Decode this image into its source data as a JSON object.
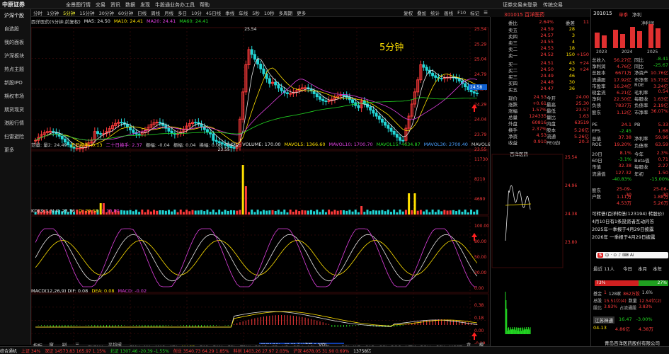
{
  "app": {
    "logo": "中原证券",
    "menu": [
      "全景图",
      "行情",
      "交易",
      "资讯",
      "数据",
      "发现",
      "牛股通",
      "业务办理",
      "工具",
      "帮助"
    ],
    "login": "证券交易未登录",
    "right_links": [
      "传统交易",
      "全"
    ]
  },
  "left_nav": [
    "沪深个股",
    "自选股",
    "我的面板",
    "沪深板块",
    "热点主题",
    "新股IPO",
    "期权市场",
    "期货现货",
    "港股行情",
    "扫雷避险",
    "更多"
  ],
  "chart_toolbar": {
    "items": [
      "分时",
      "1分钟",
      "5分钟",
      "15分钟",
      "30分钟",
      "60分钟",
      "日线",
      "周线",
      "月线",
      "多日",
      "10分",
      "45日线",
      "季线",
      "年线",
      "5秒",
      "10秒",
      "多周期",
      "更多"
    ],
    "active": "5分钟",
    "right_items": [
      "复权",
      "叠加",
      "统计",
      "画线",
      "F10",
      "标记",
      "☰"
    ]
  },
  "main_chart": {
    "title": "西洋医药(5分钟,前复权)",
    "ma_labels": [
      {
        "t": "MA5: 24.50",
        "c": "#e6e6e6"
      },
      {
        "t": "MA10: 24.41",
        "c": "#ffe000"
      },
      {
        "t": "MA20: 24.41",
        "c": "#e040e0"
      },
      {
        "t": "MA60: 24.41",
        "c": "#22d622"
      }
    ],
    "period_label": "5分钟",
    "high_label": "25.54",
    "low_label": "23.55",
    "price_axis": [
      "25.54",
      "25.29",
      "25.04",
      "24.79",
      "24.54",
      "24.29",
      "24.04",
      "23.79",
      "23.55"
    ],
    "current_price_tag": "24.58"
  },
  "vol_panel": {
    "labels": [
      {
        "t": "范量: 量2: 24.49",
        "c": "#c8c8c8"
      },
      {
        "t": "五日换手: 0.13",
        "c": "#ffe000"
      },
      {
        "t": "二十日换手: 2.37",
        "c": "#e040e0"
      },
      {
        "t": "振幅: -0.04",
        "c": "#c8c8c8"
      },
      {
        "t": "振幅: 0.04",
        "c": "#c8c8c8"
      },
      {
        "t": "换幅: 0.08",
        "c": "#c8c8c8"
      },
      {
        "t": "VVOL - VOLUME: 170.00",
        "c": "#e6e6e6"
      },
      {
        "t": "MAVOL5: 1366.60",
        "c": "#ffe000"
      },
      {
        "t": "MAVOL10: 1700.70",
        "c": "#e040e0"
      },
      {
        "t": "MAVOL15: 4634.87",
        "c": "#22d622"
      },
      {
        "t": "MAVOL30: 2700.40",
        "c": "#4aa0ff"
      },
      {
        "t": "MAVOL60: 3443.18",
        "c": "#c8c8c8"
      }
    ],
    "axis": [
      "11730",
      "8210",
      "4690"
    ]
  },
  "kdj_panel": {
    "labels": [
      {
        "t": "KDJ(9,3,3) K: 23.36",
        "c": "#e6e6e6"
      },
      {
        "t": "D: 29.58",
        "c": "#ffe000"
      },
      {
        "t": "J: 10.80",
        "c": "#e040e0"
      }
    ],
    "axis": [
      "100.00",
      "80.00",
      "50.00",
      "20.00",
      "0.00"
    ]
  },
  "macd_panel": {
    "labels": [
      {
        "t": "MACD(12,26,9) DIF: 0.08",
        "c": "#e6e6e6"
      },
      {
        "t": "DEA: 0.08",
        "c": "#ffe000"
      },
      {
        "t": "MACD: -0.02",
        "c": "#e040e0"
      }
    ],
    "axis": [
      "0.38",
      "0.18",
      "0.00",
      "-0.18"
    ],
    "tooltip": "26/04/13/一 09:30 五分涨幅-0.89%"
  },
  "index_bar": [
    "指标A",
    "窗口",
    "副图",
    "三线",
    "EXPMA",
    "平均成本",
    "EMV",
    "MA",
    "MA2",
    "KDJ",
    "MACD",
    "DMI",
    "DMA",
    "FSL",
    "TRIX",
    "BRAR",
    "CR",
    "VR",
    "OBV",
    "ASI",
    "VOL-TDX",
    "RSI",
    "WR",
    "SAR",
    "CCI",
    "ROC",
    "MTM",
    "BOLL",
    "PSY",
    "MCST",
    "龙线",
    "模板"
  ],
  "index_active": "MACD",
  "quote": {
    "stock": "301015 百洋医药",
    "webi": "委比",
    "webi_val": "2.64%",
    "wcha": "委差",
    "wcha_val": "11",
    "sells": [
      {
        "name": "卖五",
        "price": "24.59",
        "vol": "28"
      },
      {
        "name": "卖四",
        "price": "24.57",
        "vol": "3"
      },
      {
        "name": "卖三",
        "price": "24.55",
        "vol": "4"
      },
      {
        "name": "卖二",
        "price": "24.53",
        "vol": "18"
      },
      {
        "name": "卖一",
        "price": "24.52",
        "vol": "150",
        "ch": "+150"
      }
    ],
    "buys": [
      {
        "name": "买一",
        "price": "24.51",
        "vol": "43",
        "ch": "+24"
      },
      {
        "name": "买二",
        "price": "24.50",
        "vol": "43",
        "ch": "+24"
      },
      {
        "name": "买三",
        "price": "24.49",
        "vol": "46"
      },
      {
        "name": "买四",
        "price": "24.48",
        "vol": "30"
      },
      {
        "name": "买五",
        "price": "24.47",
        "vol": "36"
      }
    ],
    "stats": [
      [
        "现价",
        "24.53",
        "今开",
        "24.00"
      ],
      [
        "涨跌",
        "+0.61",
        "最高",
        "25.30"
      ],
      [
        "涨幅",
        "1.57%",
        "最低",
        "23.57"
      ],
      [
        "总量",
        "124335",
        "量比",
        "1.63"
      ],
      [
        "外盘",
        "60816",
        "内盘",
        "63519"
      ],
      [
        "换手",
        "2.37%",
        "股本",
        "5.26亿"
      ],
      [
        "净资",
        "4.53",
        "流通",
        "5.26亿"
      ],
      [
        "收益",
        "0.910",
        "PE(动)",
        "20.3"
      ]
    ],
    "mini_title": "百洋医药",
    "mini_axis": [
      "25.54",
      "24.96",
      "24.38",
      "23.80"
    ]
  },
  "fundamentals": {
    "code": "301015",
    "tabs": [
      "单季",
      "净利"
    ],
    "years": [
      "2023",
      "2024",
      "2025"
    ],
    "net_profit": "净利润",
    "rows": [
      [
        "总收入",
        "56.27亿",
        "同比",
        "-8.41"
      ],
      [
        "净利润",
        "4.76亿",
        "同比",
        "-25.67"
      ],
      [
        "总股本",
        "6671万",
        "净资产",
        "10.76亿"
      ],
      [
        "流通股",
        "17.92亿",
        "市净率",
        "15.73亿"
      ],
      [
        "市盈率",
        "16.24亿",
        "ROE",
        "3.24亿"
      ],
      [
        "现金流",
        "6.21亿",
        "毛利率",
        "0.54"
      ],
      [
        "净利",
        "22.50亿",
        "每股收",
        "1.63亿"
      ],
      [
        "负债",
        "7837万",
        "负债率",
        "2.19亿"
      ],
      [
        "股东",
        "1.12亿",
        "市净率",
        "36.07%"
      ]
    ],
    "rows2": [
      [
        "PE",
        "24.1",
        "PB",
        "5.33"
      ],
      [
        "EPS",
        "-2.45",
        "",
        "1.68"
      ],
      [
        "总值",
        "37.38",
        "净利率",
        "59.96"
      ],
      [
        "ROE",
        "19.20%",
        "负债率",
        "63.59"
      ]
    ],
    "rows3": [
      [
        "20日",
        "8.1%",
        "今年",
        "2.3%"
      ],
      [
        "60日",
        "-3.1%",
        "Beta值",
        "0.71"
      ],
      [
        "市值",
        "32.38",
        "每股收",
        "2.27"
      ],
      [
        "流通值",
        "127.32",
        "年初",
        "1.50"
      ],
      [
        "",
        "-40.83%",
        "",
        "-15.00%"
      ]
    ],
    "rows4": [
      [
        "股东",
        "25-09-30",
        "",
        "25-06-30"
      ],
      [
        "户数",
        "1.11万",
        "",
        "1.88万"
      ],
      [
        "",
        "4.53万",
        "",
        "5.26万"
      ]
    ],
    "news": [
      "可转债(百洋转债(123194) 转股价)",
      "4月10日有1条投资者互动问答",
      "2025年一季报于4月29日披露",
      "2026年 一季报于4月29日披露"
    ],
    "popup_items": [
      "中",
      "·",
      "⊙",
      "♪",
      "⌨",
      "Ai"
    ],
    "rating_label": "最近 11人",
    "rating_cols": [
      "今日",
      "本月",
      "本年"
    ],
    "rating_red": "73%",
    "rating_green": "27%",
    "prices_rows": [
      [
        "基金",
        "1",
        "128家",
        "862万股",
        "1.6%"
      ],
      [
        "总股",
        "15.51亿(4)",
        "数量",
        "12.54亿(2)"
      ],
      [
        "股比",
        "3.83%",
        "占流通股",
        "3.83%"
      ]
    ],
    "tag": "江苏神通",
    "tag_price": "16.47",
    "tag_change": "-3.00%",
    "date1": "04-13",
    "date1_v1": "4.86亿",
    "date1_v2": "4.38万",
    "bottom_company": "青岛百洋医药股份有限公司"
  },
  "bottom_bar": [
    {
      "t": "综合通机",
      "c": "#e6e6e6"
    },
    {
      "t": "上证 34%",
      "c": "#ff3b3b"
    },
    {
      "t": "深证 14573.83 165.97 1.15%",
      "c": "#ff3b3b"
    },
    {
      "t": "北证 1307.46 -20.39 -1.55%",
      "c": "#22d622"
    },
    {
      "t": "创业 3540.73 64.29 1.85%",
      "c": "#ff3b3b"
    },
    {
      "t": "科创 1403.26 27.97 2.03%",
      "c": "#ff3b3b"
    },
    {
      "t": "沪深 4678.05 31.90 0.69%",
      "c": "#ff3b3b"
    },
    {
      "t": "13758亿",
      "c": "#e6e6e6"
    }
  ]
}
